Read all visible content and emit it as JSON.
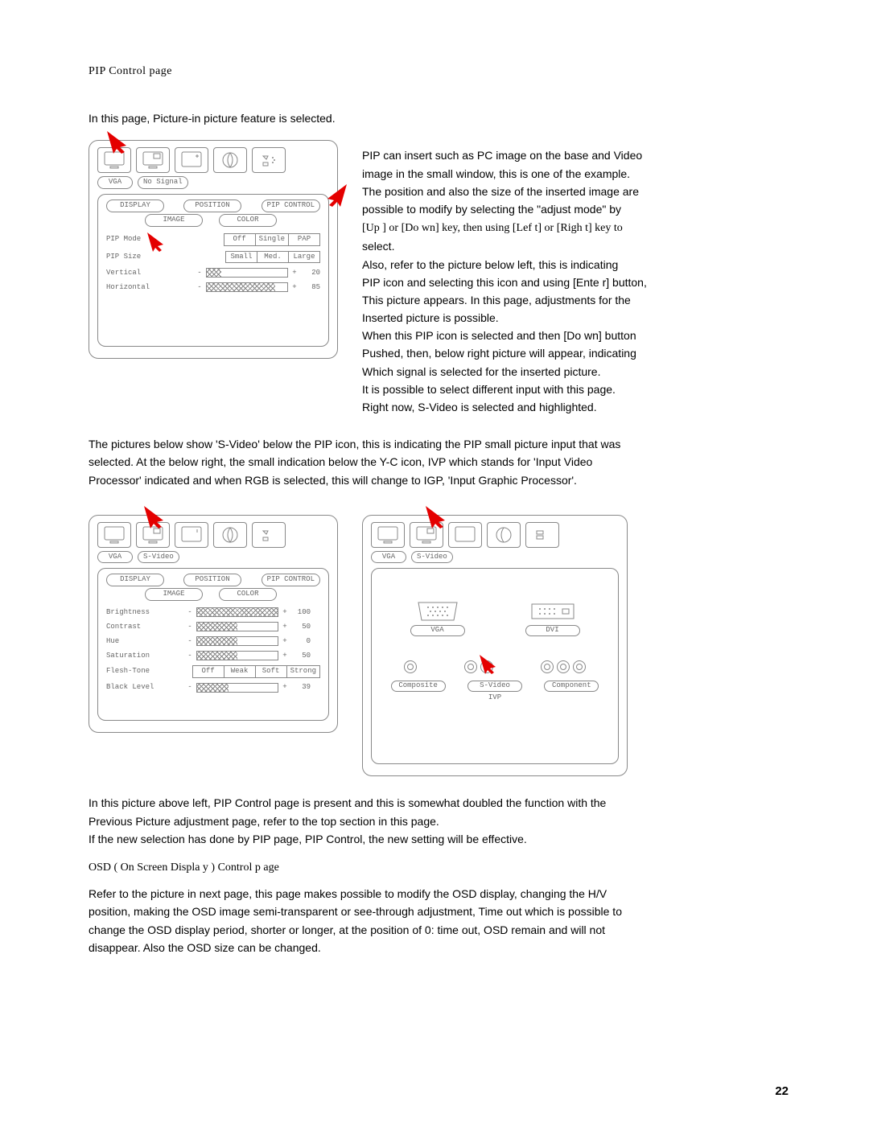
{
  "pageTitle": "PIP Control page",
  "intro": "In this page, Picture-in picture feature is selected.",
  "panel1": {
    "source1": "VGA",
    "source2": "No Signal",
    "tabs": {
      "display": "DISPLAY",
      "position": "POSITION",
      "pip": "PIP CONTROL",
      "image": "IMAGE",
      "color": "COLOR"
    },
    "rows": {
      "pipMode": {
        "label": "PIP Mode",
        "opts": [
          "Off",
          "Single",
          "PAP"
        ]
      },
      "pipSize": {
        "label": "PIP Size",
        "opts": [
          "Small",
          "Med.",
          "Large"
        ]
      },
      "vertical": {
        "label": "Vertical",
        "value": "20",
        "fill": 18
      },
      "horizontal": {
        "label": "Horizontal",
        "value": "85",
        "fill": 85
      }
    }
  },
  "rightText": {
    "l1": "PIP can insert such as PC image on the base and Video",
    "l2": "image in the small window, this is one of the example.",
    "l3": "The position and also the size of the inserted image are",
    "l4": "possible to modify by selecting the \"adjust mode\" by",
    "l5a": "[Up ] or [Do wn] key, then using [Lef t] or [Righ t] key to",
    "l5b": "select.",
    "l6": "Also, refer to the picture below left, this is indicating",
    "l7a": "PIP icon and selecting this icon and using [Ente r] button,",
    "l8": "This picture appears.    In this page, adjustments for the",
    "l9": "Inserted picture is possible.",
    "l10a": "When this PIP icon is selected and then [Do wn] button",
    "l11": "Pushed, then, below right picture will appear, indicating",
    "l12": "Which signal is selected for the inserted picture.",
    "l13": "It is possible to select different input with this page.",
    "l14": "Right now, S-Video is selected and highlighted."
  },
  "midPara": {
    "l1": "The pictures below show 'S-Video' below the PIP icon, this is indicating the PIP small picture input that was",
    "l2": "selected.   At the below right, the small indication below the Y-C icon, IVP which stands for 'Input Video",
    "l3": "Processor' indicated and when RGB is selected, this will change to IGP, 'Input Graphic Processor'."
  },
  "panel2": {
    "source1": "VGA",
    "source2": "S-Video",
    "rows": {
      "brightness": {
        "label": "Brightness",
        "value": "100",
        "fill": 100
      },
      "contrast": {
        "label": "Contrast",
        "value": "50",
        "fill": 50
      },
      "hue": {
        "label": "Hue",
        "value": "0",
        "fill": 50
      },
      "saturation": {
        "label": "Saturation",
        "value": "50",
        "fill": 50
      },
      "fleshTone": {
        "label": "Flesh-Tone",
        "opts": [
          "Off",
          "Weak",
          "Soft",
          "Strong"
        ]
      },
      "blackLevel": {
        "label": "Black Level",
        "value": "39",
        "fill": 39
      }
    }
  },
  "panel3": {
    "source1": "VGA",
    "source2": "S-Video",
    "ports": {
      "vga": "VGA",
      "dvi": "DVI"
    },
    "inputs": {
      "composite": "Composite",
      "svideo": "S-Video",
      "component": "Component"
    },
    "ivp": "IVP"
  },
  "bottomPara": {
    "l1": "In this picture above left, PIP Control page is present and this is somewhat doubled the function with the",
    "l2": "Previous Picture adjustment page, refer to the top section in this page.",
    "l3": "If the new selection has done by PIP page, PIP Control, the new setting will be effective."
  },
  "osdTitle": "OSD ( On Screen Displa    y ) Control p   age",
  "osdPara": {
    "l1": "Refer to the picture in next page, this page makes possible to modify the OSD display, changing the H/V",
    "l2": "position, making the OSD image semi-transparent or see-through adjustment, Time out which is possible to",
    "l3": "change the OSD display period, shorter or longer, at the position of 0: time out, OSD remain and will not",
    "l4": "disappear.   Also the OSD size can be changed."
  },
  "pageNum": "22"
}
